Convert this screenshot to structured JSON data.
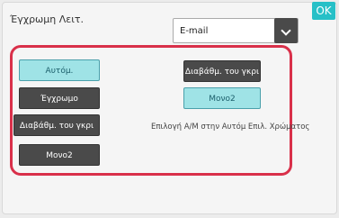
{
  "header": {
    "title": "Έγχρωμη Λειτ.",
    "ok_label": "OK"
  },
  "dropdown": {
    "value": "E-mail",
    "arrow_icon": "chevron-down-icon"
  },
  "colors": {
    "highlight_frame": "#d9304a",
    "ok_button": "#27c0c7",
    "active_button": "#9fe3e6",
    "dark_button": "#4a4a4a"
  },
  "left_buttons": [
    {
      "label": "Αυτόμ.",
      "selected": true
    },
    {
      "label": "Έγχρωμο",
      "selected": false
    },
    {
      "label": "Διαβάθμ. του γκρι",
      "selected": false
    },
    {
      "label": "Μονο2",
      "selected": false
    }
  ],
  "right_panel": {
    "gray_label": "Διαβάθμ. του γκρι",
    "mono2_label": "Μονο2",
    "mono2_selected": true,
    "description": "Επιλογή Α/Μ στην Αυτόμ Επιλ. Χρώματος"
  }
}
